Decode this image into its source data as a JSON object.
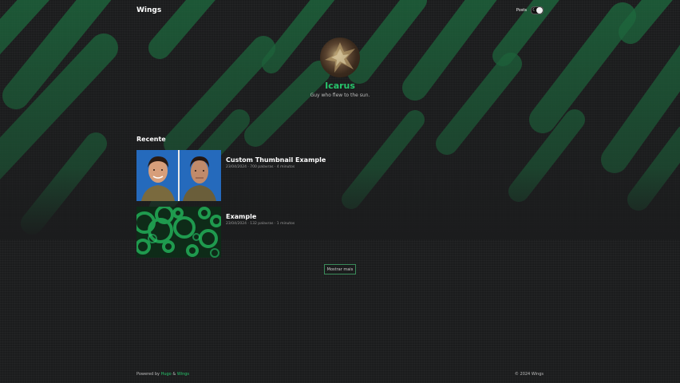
{
  "nav": {
    "brand": "Wings",
    "posts_label": "Posts"
  },
  "profile": {
    "name": "Icarus",
    "bio": "Guy who flew to the sun."
  },
  "recent": {
    "title": "Recente",
    "posts": [
      {
        "title": "Custom Thumbnail Example",
        "meta": "23/04/2024 · 700 palavras · 4 minutos"
      },
      {
        "title": "Example",
        "meta": "23/04/2024 · 132 palavras · 1 minutos"
      }
    ],
    "more_label": "Mostrar mais"
  },
  "footer": {
    "powered": "Powered by",
    "hugo": "Hugo",
    "amp": "&",
    "theme": "Wings",
    "copyright": "© 2024 Wings"
  },
  "colors": {
    "accent": "#27c46b",
    "background": "#1b1c1d"
  }
}
